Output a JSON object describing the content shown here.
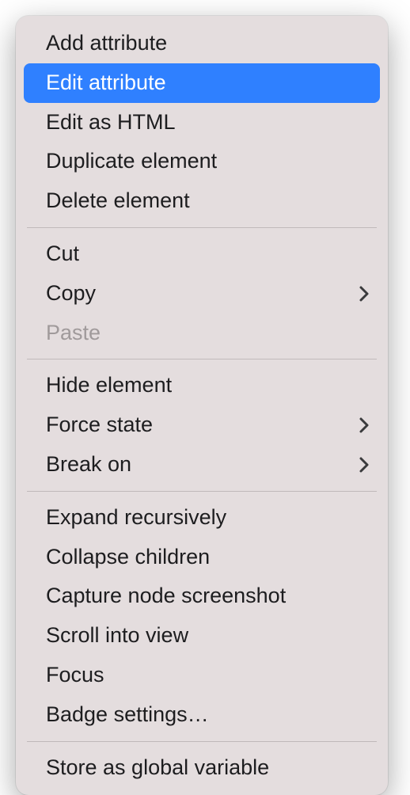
{
  "menu": {
    "groups": [
      [
        {
          "id": "add-attribute",
          "label": "Add attribute",
          "submenu": false,
          "highlighted": false,
          "disabled": false
        },
        {
          "id": "edit-attribute",
          "label": "Edit attribute",
          "submenu": false,
          "highlighted": true,
          "disabled": false
        },
        {
          "id": "edit-as-html",
          "label": "Edit as HTML",
          "submenu": false,
          "highlighted": false,
          "disabled": false
        },
        {
          "id": "duplicate-element",
          "label": "Duplicate element",
          "submenu": false,
          "highlighted": false,
          "disabled": false
        },
        {
          "id": "delete-element",
          "label": "Delete element",
          "submenu": false,
          "highlighted": false,
          "disabled": false
        }
      ],
      [
        {
          "id": "cut",
          "label": "Cut",
          "submenu": false,
          "highlighted": false,
          "disabled": false
        },
        {
          "id": "copy",
          "label": "Copy",
          "submenu": true,
          "highlighted": false,
          "disabled": false
        },
        {
          "id": "paste",
          "label": "Paste",
          "submenu": false,
          "highlighted": false,
          "disabled": true
        }
      ],
      [
        {
          "id": "hide-element",
          "label": "Hide element",
          "submenu": false,
          "highlighted": false,
          "disabled": false
        },
        {
          "id": "force-state",
          "label": "Force state",
          "submenu": true,
          "highlighted": false,
          "disabled": false
        },
        {
          "id": "break-on",
          "label": "Break on",
          "submenu": true,
          "highlighted": false,
          "disabled": false
        }
      ],
      [
        {
          "id": "expand-recursively",
          "label": "Expand recursively",
          "submenu": false,
          "highlighted": false,
          "disabled": false
        },
        {
          "id": "collapse-children",
          "label": "Collapse children",
          "submenu": false,
          "highlighted": false,
          "disabled": false
        },
        {
          "id": "capture-node-screenshot",
          "label": "Capture node screenshot",
          "submenu": false,
          "highlighted": false,
          "disabled": false
        },
        {
          "id": "scroll-into-view",
          "label": "Scroll into view",
          "submenu": false,
          "highlighted": false,
          "disabled": false
        },
        {
          "id": "focus",
          "label": "Focus",
          "submenu": false,
          "highlighted": false,
          "disabled": false
        },
        {
          "id": "badge-settings",
          "label": "Badge settings…",
          "submenu": false,
          "highlighted": false,
          "disabled": false
        }
      ],
      [
        {
          "id": "store-as-global-variable",
          "label": "Store as global variable",
          "submenu": false,
          "highlighted": false,
          "disabled": false
        }
      ]
    ]
  }
}
